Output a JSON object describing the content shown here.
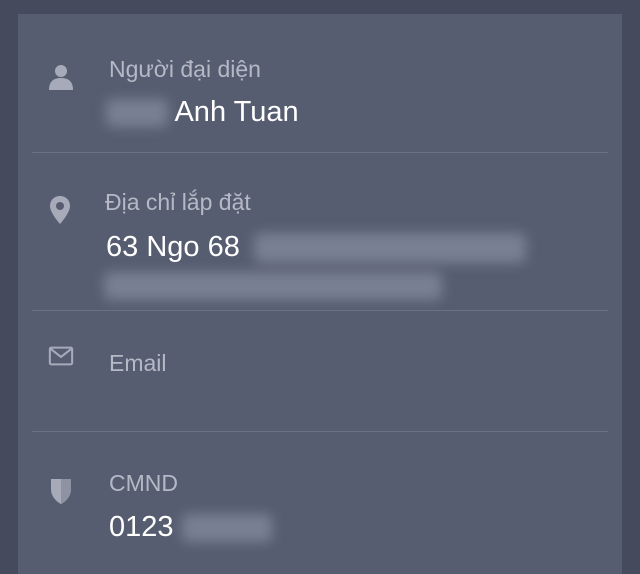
{
  "fields": {
    "representative": {
      "label": "Người đại diện",
      "value": "Anh Tuan",
      "icon": "user-icon"
    },
    "address": {
      "label": "Địa chỉ lắp đặt",
      "value": "63 Ngo 68",
      "icon": "location-pin-icon"
    },
    "email": {
      "label": "Email",
      "value": "",
      "icon": "mail-icon"
    },
    "id_number": {
      "label": "CMND",
      "value": "0123",
      "icon": "shield-icon"
    }
  },
  "colors": {
    "background": "#454a5c",
    "card": "#575d70",
    "label": "#b5b9c6",
    "value": "#ffffff",
    "icon": "#a7abb9"
  }
}
